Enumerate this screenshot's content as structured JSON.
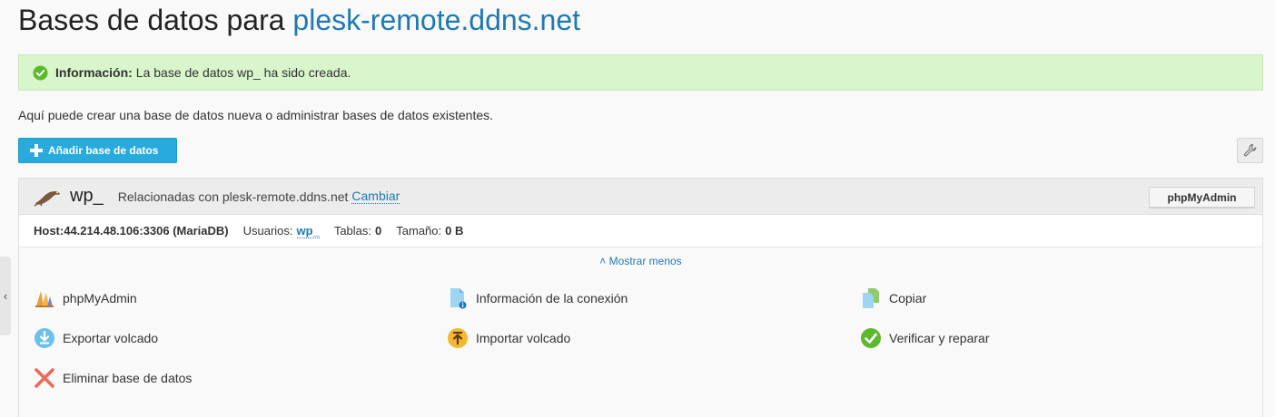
{
  "page": {
    "title_prefix": "Bases de datos para",
    "title_domain": "plesk-remote.ddns.net"
  },
  "message": {
    "label": "Información:",
    "text": "La base de datos wp_ ha sido creada."
  },
  "hint": "Aquí puede crear una base de datos nueva o administrar bases de datos existentes.",
  "toolbar": {
    "add_label": "Añadir base de datos"
  },
  "database": {
    "name": "wp_",
    "related_text": "Relacionadas con plesk-remote.ddns.net",
    "change_label": "Cambiar",
    "pma_button": "phpMyAdmin",
    "host": "Host:44.214.48.106:3306 (MariaDB)",
    "users_label": "Usuarios:",
    "users_value": "wp_",
    "tables_label": "Tablas:",
    "tables_value": "0",
    "size_label": "Tamaño:",
    "size_value": "0 B",
    "toggle_label": "Mostrar menos",
    "actions": [
      {
        "label": "phpMyAdmin",
        "icon": "phpmyadmin-icon"
      },
      {
        "label": "Información de la conexión",
        "icon": "connection-info-icon"
      },
      {
        "label": "Copiar",
        "icon": "copy-icon"
      },
      {
        "label": "Exportar volcado",
        "icon": "export-dump-icon"
      },
      {
        "label": "Importar volcado",
        "icon": "import-dump-icon"
      },
      {
        "label": "Verificar y reparar",
        "icon": "check-repair-icon"
      },
      {
        "label": "Eliminar base de datos",
        "icon": "delete-icon"
      }
    ]
  },
  "colors": {
    "accent": "#1f7ab3",
    "button_blue": "#28aadc",
    "success_bg": "#d8f5cc",
    "success_icon": "#5cb82e"
  }
}
